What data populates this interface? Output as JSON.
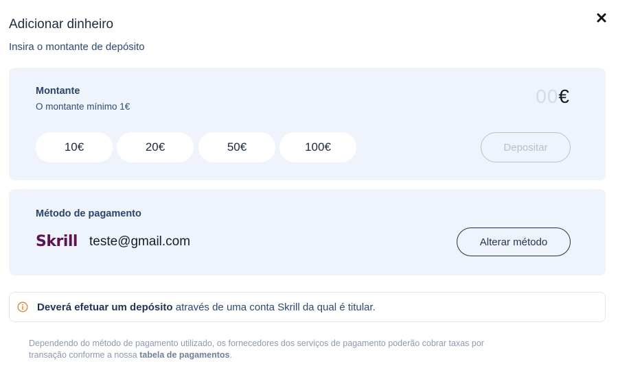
{
  "modal": {
    "title": "Adicionar dinheiro",
    "subtitle": "Insira o montante de depósito",
    "close_icon": "close-icon"
  },
  "amount_card": {
    "label": "Montante",
    "hint": "O montante mínimo 1€",
    "amount_digits": "00",
    "currency": "€",
    "quick_amounts": [
      "10€",
      "20€",
      "50€",
      "100€"
    ],
    "deposit_label": "Depositar"
  },
  "method_card": {
    "label": "Método de pagamento",
    "provider_logo_text": "Skrill",
    "email": "teste@gmail.com",
    "change_label": "Alterar método"
  },
  "notice": {
    "icon": "info-icon",
    "bold_text": "Deverá efetuar um depósito",
    "rest_text": " através de uma conta Skrill da qual é titular."
  },
  "footer": {
    "text_line1": "Dependendo do método de pagamento utilizado, os fornecedores dos serviços de pagamento poderão cobrar taxas por",
    "text_line2": "transação conforme a nossa ",
    "link_text": "tabela de pagamentos",
    "end": "."
  },
  "colors": {
    "card_bg": "#eff3fb",
    "primary_text": "#1f3352",
    "skrill_brand": "#5e1451",
    "warning_orange": "#e67e22",
    "disabled": "#b2c1d4"
  }
}
